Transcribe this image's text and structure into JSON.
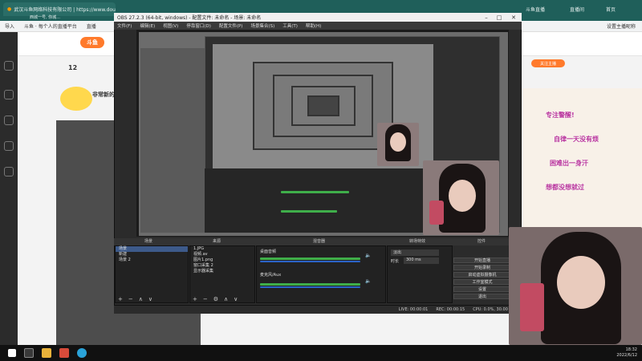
{
  "browser": {
    "tabs": [
      {
        "label": "武汉斗鱼网络科技有限公司 | https://www.douyu.com/10073870"
      },
      {
        "label": "西城一号, 你城..."
      },
      {
        "label": "京东 每个人的直播平台"
      },
      {
        "label": "斗鱼直播"
      },
      {
        "label": "直播间"
      },
      {
        "label": "首页"
      }
    ],
    "bookmarks": [
      "导入",
      "斗鱼 · 每个人的直播平台",
      "直播"
    ],
    "right_tabs": [
      "设置主播昵称",
      "注册",
      "已暂停"
    ]
  },
  "site": {
    "logo_text": "斗鱼",
    "level_num": "12",
    "promo_text": "非常新的",
    "banner_cta": "关注主播"
  },
  "stickers": [
    "专注警醒!",
    "自律一天没有烦",
    "困难出一身汗",
    "想都没想就过"
  ],
  "obs": {
    "title": "OBS 27.2.3 (64-bit, windows) - 配置文件: 未命名 - 场景: 未命名",
    "menu": [
      "文件(F)",
      "编辑(E)",
      "视图(V)",
      "停靠窗口(D)",
      "配置文件(P)",
      "场景集合(S)",
      "工具(T)",
      "帮助(H)"
    ],
    "docks": {
      "scenes_header": "场景",
      "sources_header": "来源",
      "mixer_header": "混音器",
      "transitions_header": "转场特效",
      "controls_header": "控件"
    },
    "scenes": [
      "场景",
      "新建",
      "场景 2"
    ],
    "sources": [
      "1.JPG",
      "视频.av",
      "图片1.png",
      "窗口采集 2",
      "显示器采集"
    ],
    "mixer": [
      {
        "name": "桌面音频",
        "level": "0.0 dB"
      },
      {
        "name": "麦克风/Aux",
        "level": "0.0 dB"
      }
    ],
    "transition": {
      "type": "淡出",
      "duration_label": "时长",
      "duration": "300 ms"
    },
    "controls": [
      "开始直播",
      "开始录制",
      "启动虚拟摄像机",
      "工作室模式",
      "设置",
      "退出"
    ],
    "status": {
      "live": "LIVE: 00:00:01",
      "rec": "REC: 00:00:15",
      "cpu": "CPU: 0.0%, 30.00 fps"
    }
  },
  "taskbar": {
    "time": "18:32",
    "date": "2022/6/12"
  }
}
